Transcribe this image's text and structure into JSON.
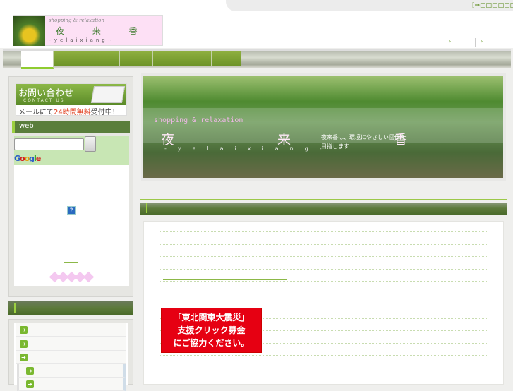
{
  "header": {
    "top_link": "[⇒□□□□□□]",
    "logo": {
      "tagline": "shopping & relaxation",
      "name": "夜 来 香",
      "romaji": "~yelaixiang~"
    },
    "links": [
      "›",
      "›"
    ]
  },
  "nav": {
    "tabs": [
      "",
      "",
      "",
      "",
      "",
      "",
      ""
    ],
    "active_index": 0
  },
  "sidebar": {
    "contact": {
      "title": "お問い合わせ",
      "subtitle": "CONTACT US",
      "note_prefix": "メールにて",
      "note_highlight": "24時間無料",
      "note_suffix": "受付中！"
    },
    "web_title": "web",
    "search": {
      "value": "",
      "button": ""
    },
    "google_logo": "Google",
    "help_icon": "?",
    "menu_items": [
      "",
      "",
      "",
      "",
      ""
    ]
  },
  "main": {
    "banner": {
      "tagline": "shopping & relaxation",
      "name": "夜 来 香",
      "romaji": "-yelaixiang-",
      "description": "夜来香は、環境にやさしい団体を目指します"
    },
    "donation": {
      "line1": "「東北関東大震災」",
      "line2": "支援クリック募金",
      "line3": "にご協力ください。"
    }
  }
}
